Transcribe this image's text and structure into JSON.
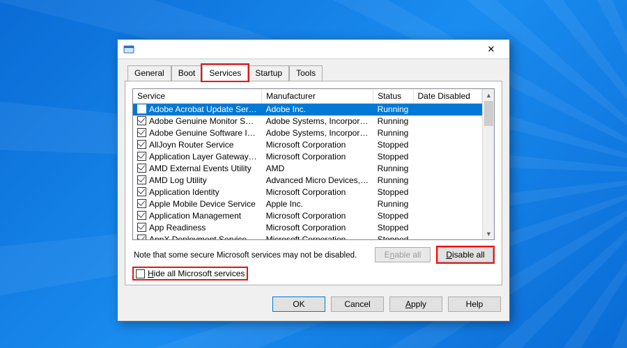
{
  "window": {
    "close": "✕"
  },
  "tabs": {
    "general": "General",
    "boot": "Boot",
    "services": "Services",
    "startup": "Startup",
    "tools": "Tools",
    "active": "services"
  },
  "columns": {
    "service": "Service",
    "manufacturer": "Manufacturer",
    "status": "Status",
    "date_disabled": "Date Disabled"
  },
  "rows": [
    {
      "checked": true,
      "selected": true,
      "service": "Adobe Acrobat Update Service",
      "manufacturer": "Adobe Inc.",
      "status": "Running",
      "date_disabled": ""
    },
    {
      "checked": true,
      "selected": false,
      "service": "Adobe Genuine Monitor Service",
      "manufacturer": "Adobe Systems, Incorpora...",
      "status": "Running",
      "date_disabled": ""
    },
    {
      "checked": true,
      "selected": false,
      "service": "Adobe Genuine Software Integri...",
      "manufacturer": "Adobe Systems, Incorpora...",
      "status": "Running",
      "date_disabled": ""
    },
    {
      "checked": true,
      "selected": false,
      "service": "AllJoyn Router Service",
      "manufacturer": "Microsoft Corporation",
      "status": "Stopped",
      "date_disabled": ""
    },
    {
      "checked": true,
      "selected": false,
      "service": "Application Layer Gateway Service",
      "manufacturer": "Microsoft Corporation",
      "status": "Stopped",
      "date_disabled": ""
    },
    {
      "checked": true,
      "selected": false,
      "service": "AMD External Events Utility",
      "manufacturer": "AMD",
      "status": "Running",
      "date_disabled": ""
    },
    {
      "checked": true,
      "selected": false,
      "service": "AMD Log Utility",
      "manufacturer": "Advanced Micro Devices, I...",
      "status": "Running",
      "date_disabled": ""
    },
    {
      "checked": true,
      "selected": false,
      "service": "Application Identity",
      "manufacturer": "Microsoft Corporation",
      "status": "Stopped",
      "date_disabled": ""
    },
    {
      "checked": true,
      "selected": false,
      "service": "Apple Mobile Device Service",
      "manufacturer": "Apple Inc.",
      "status": "Running",
      "date_disabled": ""
    },
    {
      "checked": true,
      "selected": false,
      "service": "Application Management",
      "manufacturer": "Microsoft Corporation",
      "status": "Stopped",
      "date_disabled": ""
    },
    {
      "checked": true,
      "selected": false,
      "service": "App Readiness",
      "manufacturer": "Microsoft Corporation",
      "status": "Stopped",
      "date_disabled": ""
    },
    {
      "checked": true,
      "selected": false,
      "service": "AppX Deployment Service (AppX...",
      "manufacturer": "Microsoft Corporation",
      "status": "Stopped",
      "date_disabled": ""
    }
  ],
  "note": "Note that some secure Microsoft services may not be disabled.",
  "buttons": {
    "enable_all_pre": "E",
    "enable_all_und": "n",
    "enable_all_post": "able all",
    "disable_all_pre": "",
    "disable_all_und": "D",
    "disable_all_post": "isable all",
    "hide_ms_pre": "",
    "hide_ms_und": "H",
    "hide_ms_post": "ide all Microsoft services",
    "ok": "OK",
    "cancel": "Cancel",
    "apply_pre": "",
    "apply_und": "A",
    "apply_post": "pply",
    "help": "Help"
  }
}
